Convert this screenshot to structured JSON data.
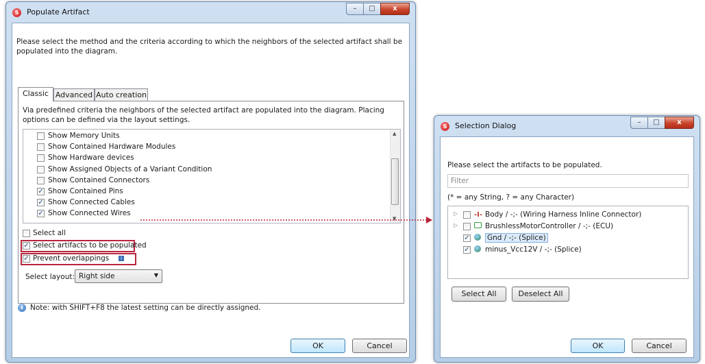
{
  "populate": {
    "title": "Populate Artifact",
    "caption_min": "–",
    "caption_max": "□",
    "caption_close": "x",
    "intro": "Please select the method and the criteria according to which the neighbors of the selected artifact shall be populated into the diagram.",
    "tabs": [
      {
        "label": "Classic"
      },
      {
        "label": "Advanced"
      },
      {
        "label": "Auto creation"
      }
    ],
    "tab_description": "Via predefined criteria the neighbors of the selected artifact are populated into the diagram. Placing options can be defined via the layout settings.",
    "list_items": [
      {
        "label": "Show Memory Units",
        "checked": false
      },
      {
        "label": "Show Contained Hardware Modules",
        "checked": false
      },
      {
        "label": "Show Hardware devices",
        "checked": false
      },
      {
        "label": "Show Assigned Objects of a Variant Condition",
        "checked": false
      },
      {
        "label": "Show Contained Connectors",
        "checked": false
      },
      {
        "label": "Show Contained Pins",
        "checked": true
      },
      {
        "label": "Show Connected Cables",
        "checked": true
      },
      {
        "label": "Show Connected Wires",
        "checked": true
      }
    ],
    "select_all_label": "Select all",
    "select_artifacts_label": "Select artifacts to be populated",
    "prevent_overlap_label": "Prevent overlappings",
    "layout_label": "Select layout:",
    "layout_value": "Right side",
    "note": "Note: with SHIFT+F8 the latest setting can be directly assigned.",
    "ok": "OK",
    "cancel": "Cancel"
  },
  "selection": {
    "title": "Selection Dialog",
    "caption_min": "–",
    "caption_max": "□",
    "caption_close": "x",
    "prompt": "Please select the artifacts to be populated.",
    "filter_placeholder": "Filter",
    "hint": "(* = any String, ? = any Character)",
    "items": [
      {
        "label": "Body / -;- (Wiring Harness Inline Connector)",
        "icon": "connector-icon",
        "checked": false,
        "expandable": true
      },
      {
        "label": "BrushlessMotorController / -;- (ECU)",
        "icon": "ecu-icon",
        "checked": false,
        "expandable": true
      },
      {
        "label": "Gnd / -;- (Splice)",
        "icon": "splice-icon",
        "checked": true,
        "expandable": false,
        "selected": true
      },
      {
        "label": "minus_Vcc12V / -;- (Splice)",
        "icon": "splice-icon",
        "checked": true,
        "expandable": false
      }
    ],
    "select_all": "Select All",
    "deselect_all": "Deselect All",
    "ok": "OK",
    "cancel": "Cancel"
  },
  "colors": {
    "accent_red": "#b8243c",
    "title_blue": "#b6cde6"
  }
}
